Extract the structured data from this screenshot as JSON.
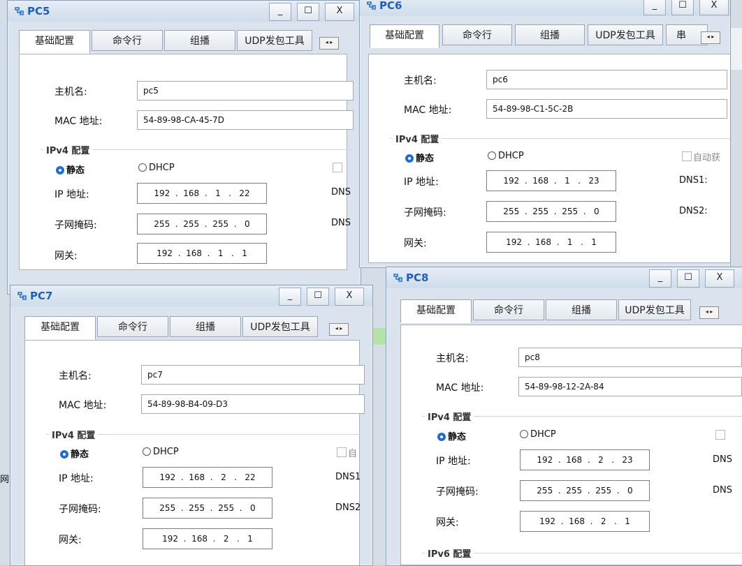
{
  "windows": [
    {
      "title": "PC5",
      "tabs": [
        "基础配置",
        "命令行",
        "组播",
        "UDP发包工具"
      ],
      "labels": {
        "hostname": "主机名:",
        "mac": "MAC 地址:",
        "ipv4": "IPv4 配置",
        "static": "静态",
        "dhcp": "DHCP",
        "ip": "IP 地址:",
        "mask": "子网掩码:",
        "gateway": "网关:"
      },
      "hostname": "pc5",
      "mac": "54-89-98-CA-45-7D",
      "ip": "192  .  168  .   1   .   22",
      "mask": "255  .  255  .  255  .   0",
      "gateway": "192  .  168  .   1   .   1",
      "dns1": "DNS",
      "dns2": "DNS",
      "auto": ""
    },
    {
      "title": "PC6",
      "tabs": [
        "基础配置",
        "命令行",
        "组播",
        "UDP发包工具",
        "串"
      ],
      "labels": {
        "hostname": "主机名:",
        "mac": "MAC 地址:",
        "ipv4": "IPv4 配置",
        "static": "静态",
        "dhcp": "DHCP",
        "ip": "IP 地址:",
        "mask": "子网掩码:",
        "gateway": "网关:"
      },
      "hostname": "pc6",
      "mac": "54-89-98-C1-5C-2B",
      "ip": "192  .  168  .   1   .   23",
      "mask": "255  .  255  .  255  .   0",
      "gateway": "192  .  168  .   1   .   1",
      "dns1": "DNS1:",
      "dns2": "DNS2:",
      "auto": "自动获"
    },
    {
      "title": "PC7",
      "tabs": [
        "基础配置",
        "命令行",
        "组播",
        "UDP发包工具"
      ],
      "labels": {
        "hostname": "主机名:",
        "mac": "MAC 地址:",
        "ipv4": "IPv4 配置",
        "static": "静态",
        "dhcp": "DHCP",
        "ip": "IP 地址:",
        "mask": "子网掩码:",
        "gateway": "网关:"
      },
      "hostname": "pc7",
      "mac": "54-89-98-B4-09-D3",
      "ip": "192  .  168  .   2   .   22",
      "mask": "255  .  255  .  255  .   0",
      "gateway": "192  .  168  .   2   .   1",
      "dns1": "DNS1",
      "dns2": "DNS2",
      "auto": "自"
    },
    {
      "title": "PC8",
      "tabs": [
        "基础配置",
        "命令行",
        "组播",
        "UDP发包工具"
      ],
      "labels": {
        "hostname": "主机名:",
        "mac": "MAC 地址:",
        "ipv4": "IPv4 配置",
        "ipv6": "IPv6 配置",
        "static": "静态",
        "dhcp": "DHCP",
        "ip": "IP 地址:",
        "mask": "子网掩码:",
        "gateway": "网关:"
      },
      "hostname": "pc8",
      "mac": "54-89-98-12-2A-84",
      "ip": "192  .  168  .   2   .   23",
      "mask": "255  .  255  .  255  .   0",
      "gateway": "192  .  168  .   2   .   1",
      "dns1": "DNS",
      "dns2": "DNS",
      "auto": ""
    }
  ],
  "window_buttons": {
    "minimize": "_",
    "maximize": "☐",
    "close": "X"
  },
  "background_text": {
    "left_char": "网"
  },
  "icons": {
    "title": "network-pc-icon",
    "scroll": "scroll-arrows-icon"
  },
  "colors": {
    "title_text": "#1f5fb8",
    "radio_on": "#1f6fd0",
    "window_bg": "#dbe4ee"
  }
}
